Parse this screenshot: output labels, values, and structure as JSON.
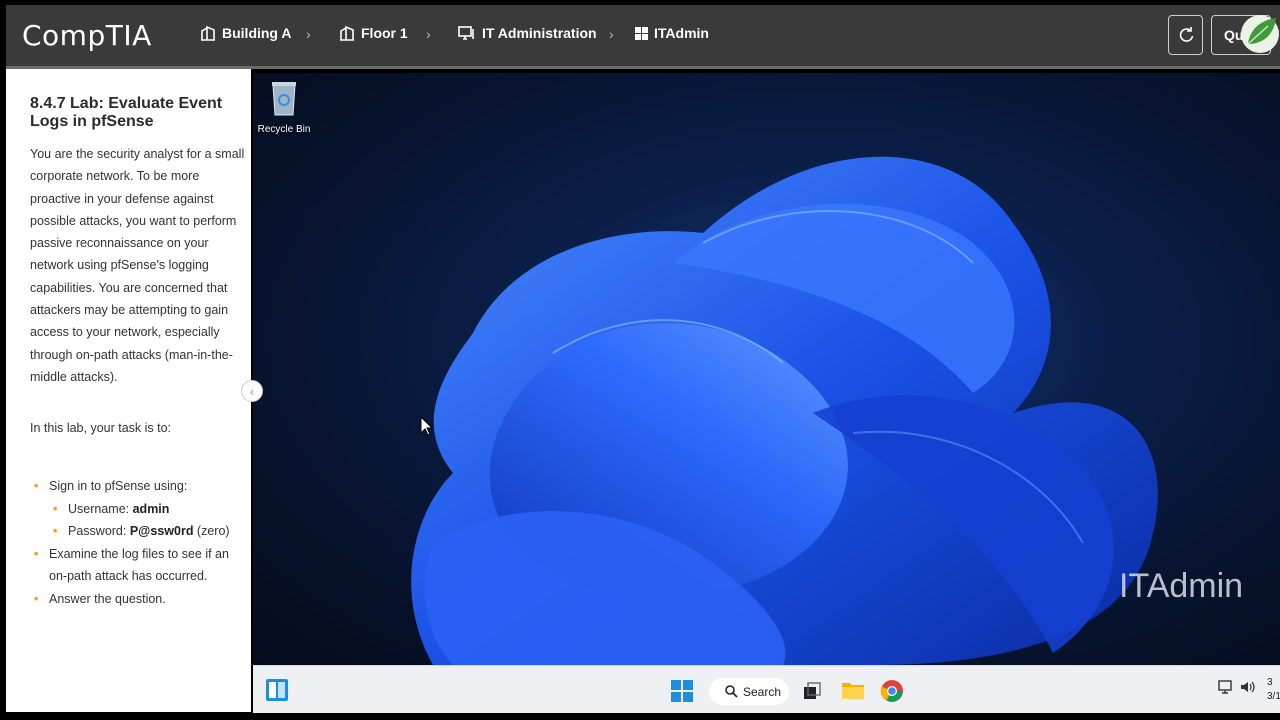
{
  "header": {
    "logo": "CompTIA",
    "breadcrumbs": [
      {
        "label": "Building A",
        "icon": "building-icon"
      },
      {
        "label": "Floor 1",
        "icon": "building-icon"
      },
      {
        "label": "IT Administration",
        "icon": "computer-icon"
      },
      {
        "label": "ITAdmin",
        "icon": "windows-icon"
      }
    ],
    "reset_icon": "refresh-icon",
    "quit_label": "Qu"
  },
  "panel": {
    "title": "8.4.7 Lab: Evaluate Event Logs in pfSense",
    "intro": "You are the security analyst for a small corporate network. To be more proactive in your defense against possible attacks, you want to perform passive reconnaissance on your network using pfSense's logging capabilities. You are concerned that attackers may be attempting to gain access to your network, especially through on-path attacks (man-in-the-middle attacks).",
    "task_intro": "In this lab, your task is to:",
    "tasks": {
      "signin": "Sign in to pfSense using:",
      "username_label": "Username: ",
      "username_value": "admin",
      "password_label": "Password: ",
      "password_value": "P@ssw0rd",
      "password_note": " (zero)",
      "examine": "Examine the log files to see if an on-path attack has occurred.",
      "answer": "Answer the question."
    },
    "collapse_icon": "chevron-left-icon"
  },
  "desktop": {
    "recycle_bin": "Recycle Bin",
    "watermark": "ITAdmin"
  },
  "taskbar": {
    "search_label": "Search",
    "clock_line1": "3",
    "clock_line2": "3/1"
  },
  "colors": {
    "header_bg": "#3a3a3a",
    "bullet": "#f0a020",
    "desktop_bg": "#07132e",
    "bloom": "#1e5cf0"
  }
}
